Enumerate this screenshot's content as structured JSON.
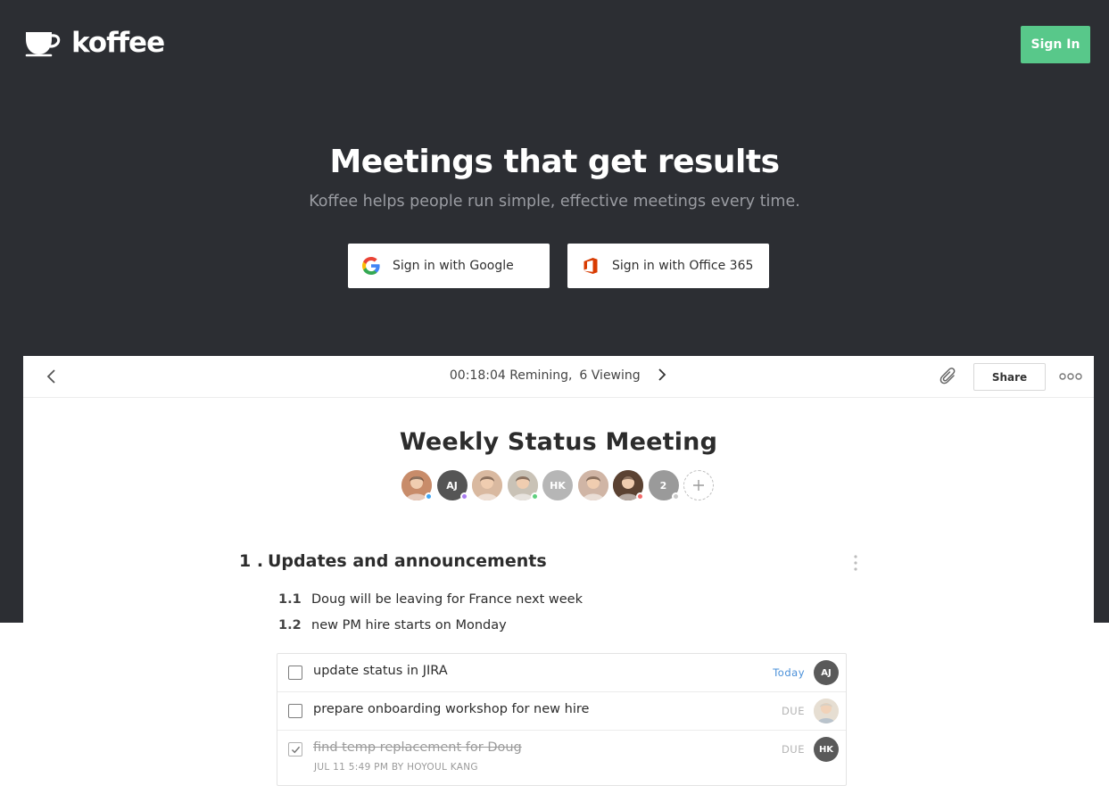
{
  "header": {
    "logo_text": "koffee",
    "signin_label": "Sign In"
  },
  "hero": {
    "title": "Meetings that get results",
    "subtitle": "Koffee helps people run simple, effective meetings every time.",
    "google_label": "Sign in with Google",
    "office_label": "Sign in with Office 365"
  },
  "app": {
    "timer_text": "00:18:04 Remining,",
    "viewing_text": "6 Viewing",
    "share_label": "Share",
    "meeting_title": "Weekly Status Meeting",
    "attendees": [
      {
        "kind": "photo",
        "label": "",
        "bg": "#c88c6a",
        "status": "#3ea6f5"
      },
      {
        "kind": "initials",
        "label": "AJ",
        "bg": "#555555",
        "status": "#a97cf0"
      },
      {
        "kind": "photo",
        "label": "",
        "bg": "#d9b9a0",
        "status": ""
      },
      {
        "kind": "photo",
        "label": "",
        "bg": "#c9c2b6",
        "status": "#5fd07e"
      },
      {
        "kind": "initials",
        "label": "HK",
        "bg": "#b6b6b6",
        "status": ""
      },
      {
        "kind": "photo",
        "label": "",
        "bg": "#d0b5a5",
        "status": ""
      },
      {
        "kind": "photo",
        "label": "",
        "bg": "#5b4232",
        "status": "#f26b6b"
      },
      {
        "kind": "initials",
        "label": "2",
        "bg": "#9a9a9a",
        "status": "#c9c9c9"
      }
    ],
    "section": {
      "number": "1 .",
      "title": "Updates and announcements",
      "notes": [
        {
          "num": "1.1",
          "text": "Doug will be leaving for France next week"
        },
        {
          "num": "1.2",
          "text": "new PM hire starts on Monday"
        }
      ]
    },
    "tasks": [
      {
        "text": "update status in JIRA",
        "due": "Today",
        "assignee": "AJ",
        "done": false
      },
      {
        "text": "prepare onboarding workshop for new hire",
        "due": "DUE",
        "assignee": "",
        "done": false
      },
      {
        "text": "find temp replacement for Doug",
        "due": "DUE",
        "assignee": "HK",
        "done": true,
        "meta": "JUL 11 5:49 PM BY HOYOUL KANG"
      }
    ]
  },
  "colors": {
    "dark_bg": "#2c2e33",
    "accent_green": "#58c88a",
    "today_blue": "#4a90d9"
  }
}
